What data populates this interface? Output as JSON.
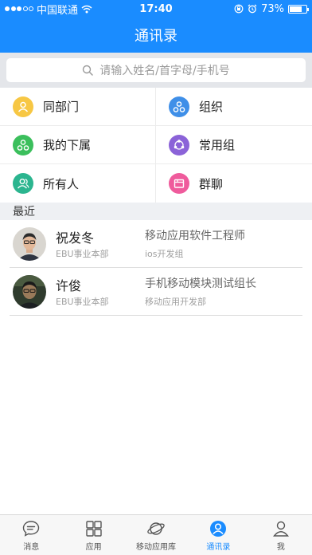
{
  "status_bar": {
    "carrier": "中国联通",
    "time": "17:40",
    "battery": "73%",
    "battery_level": 0.73
  },
  "nav": {
    "title": "通讯录"
  },
  "search": {
    "placeholder": "请输入姓名/首字母/手机号"
  },
  "categories": [
    {
      "label": "同部门",
      "icon": "person-icon",
      "color": "#f7c744"
    },
    {
      "label": "组织",
      "icon": "org-icon",
      "color": "#3f8fe8"
    },
    {
      "label": "我的下属",
      "icon": "org-icon",
      "color": "#3bbf5c"
    },
    {
      "label": "常用组",
      "icon": "group-icon",
      "color": "#8b63d8"
    },
    {
      "label": "所有人",
      "icon": "people-icon",
      "color": "#2bb58f"
    },
    {
      "label": "群聊",
      "icon": "folder-icon",
      "color": "#ef5b9c"
    }
  ],
  "recent": {
    "heading": "最近",
    "contacts": [
      {
        "name": "祝发冬",
        "dept": "EBU事业本部",
        "title": "移动应用软件工程师",
        "team": "ios开发组"
      },
      {
        "name": "许俊",
        "dept": "EBU事业本部",
        "title": "手机移动模块测试组长",
        "team": "移动应用开发部"
      }
    ]
  },
  "tabs": [
    {
      "label": "消息",
      "icon": "chat-icon"
    },
    {
      "label": "应用",
      "icon": "apps-icon"
    },
    {
      "label": "移动应用库",
      "icon": "planet-icon"
    },
    {
      "label": "通讯录",
      "icon": "contacts-icon",
      "active": true
    },
    {
      "label": "我",
      "icon": "user-icon"
    }
  ],
  "colors": {
    "primary": "#1a8cff"
  }
}
